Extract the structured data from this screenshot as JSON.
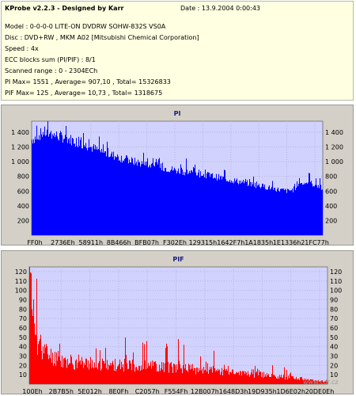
{
  "header": {
    "title": "KProbe v2.2.3 - Designed by Karr",
    "date": "Date : 13.9.2004 0:00:43",
    "lines": [
      "Model : 0-0-0-0 LITE-ON DVDRW SOHW-832S  VS0A",
      "Disc : DVD+RW ,  MKM A02 [Mitsubishi Chemical Corporation]",
      "Speed : 4x",
      "ECC blocks sum (PI/PIF) : 8/1",
      "Scanned range : 0 - 2304ECh",
      "PI Max= 1551 , Average= 907,10 , Total= 15326833",
      "PIF Max= 125 , Average= 10,73 , Total= 1318675"
    ]
  },
  "watermark": "www.cdr.cz",
  "colors": {
    "info_bg": "#ffffe1",
    "plot_bg": "#d2d2ff",
    "pi": "#0000ff",
    "pif": "#ff0000",
    "panel": "#d4d0c8"
  },
  "chart_data": [
    {
      "type": "area",
      "title": "PI",
      "ylim": [
        0,
        1550
      ],
      "yticks": [
        "200",
        "400",
        "600",
        "800",
        "1 000",
        "1 200",
        "1 400"
      ],
      "ytick_values": [
        200,
        400,
        600,
        800,
        1000,
        1200,
        1400
      ],
      "xticks": [
        "FF0h",
        "2736Eh",
        "58911h",
        "8B466h",
        "BFB07h",
        "F302Eh",
        "129315h",
        "1642F7h",
        "1A1835h",
        "1E1336h",
        "21FC77h"
      ],
      "x_range": [
        "0",
        "2304ECh"
      ],
      "grid": true,
      "series": [
        {
          "x": [
            0,
            0.04,
            0.08,
            0.12,
            0.16,
            0.2,
            0.25,
            0.3,
            0.35,
            0.4,
            0.45,
            0.5,
            0.55,
            0.6,
            0.65,
            0.7,
            0.75,
            0.8,
            0.85,
            0.88,
            0.9,
            0.92,
            0.95,
            1
          ],
          "values": [
            1300,
            1400,
            1360,
            1320,
            1260,
            1200,
            1120,
            1060,
            1000,
            960,
            920,
            880,
            850,
            820,
            780,
            740,
            700,
            660,
            620,
            600,
            620,
            700,
            720,
            650
          ]
        }
      ]
    },
    {
      "type": "area",
      "title": "PIF",
      "ylim": [
        0,
        125
      ],
      "yticks": [
        "10",
        "20",
        "30",
        "40",
        "50",
        "60",
        "70",
        "80",
        "90",
        "100",
        "110",
        "120"
      ],
      "ytick_values": [
        10,
        20,
        30,
        40,
        50,
        60,
        70,
        80,
        90,
        100,
        110,
        120
      ],
      "xticks": [
        "100Eh",
        "2B7B5h",
        "5E012h",
        "8E0Fh",
        "C2057h",
        "F554Fh",
        "12B007h",
        "1648D3h",
        "19D935h",
        "1D6E02h",
        "20DE0Eh"
      ],
      "x_range": [
        "0",
        "2304ECh"
      ],
      "grid": true,
      "series": [
        {
          "x": [
            0,
            0.02,
            0.04,
            0.07,
            0.1,
            0.15,
            0.2,
            0.25,
            0.3,
            0.35,
            0.4,
            0.45,
            0.5,
            0.6,
            0.7,
            0.8,
            0.9,
            0.95,
            1
          ],
          "values": [
            118,
            50,
            38,
            30,
            26,
            23,
            22,
            21,
            20,
            20,
            19,
            19,
            17,
            15,
            12,
            9,
            6,
            4,
            3
          ]
        }
      ]
    }
  ]
}
